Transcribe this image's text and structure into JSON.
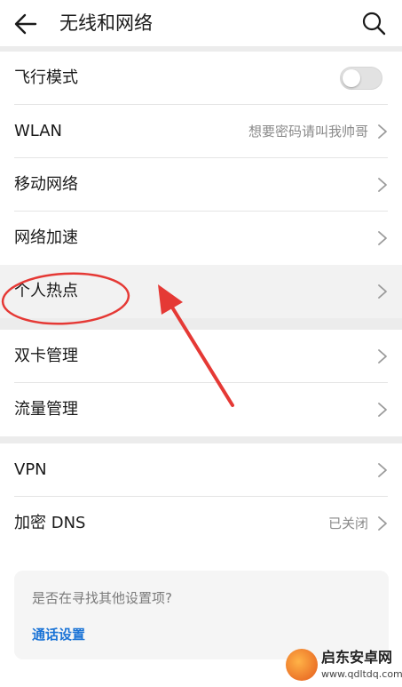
{
  "header": {
    "title": "无线和网络",
    "back_icon": "back-arrow-icon",
    "search_icon": "search-icon"
  },
  "section1": {
    "items": [
      {
        "label": "飞行模式",
        "toggle": false
      },
      {
        "label": "WLAN",
        "value": "想要密码请叫我帅哥"
      },
      {
        "label": "移动网络"
      },
      {
        "label": "网络加速"
      },
      {
        "label": "个人热点"
      }
    ]
  },
  "section2": {
    "items": [
      {
        "label": "双卡管理"
      },
      {
        "label": "流量管理"
      }
    ]
  },
  "section3": {
    "items": [
      {
        "label": "VPN"
      },
      {
        "label": "加密 DNS",
        "value": "已关闭"
      }
    ]
  },
  "suggest": {
    "question": "是否在寻找其他设置项?",
    "link": "通话设置"
  },
  "annotation": {
    "color": "#e53935"
  },
  "watermark": {
    "title": "启东安卓网",
    "url": "www.qdltdq.com"
  }
}
